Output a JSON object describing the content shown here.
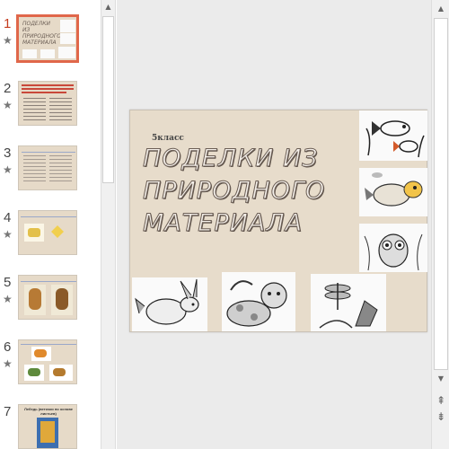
{
  "thumbnails": [
    {
      "number": "1",
      "star": "★",
      "active": true
    },
    {
      "number": "2",
      "star": "★"
    },
    {
      "number": "3",
      "star": "★"
    },
    {
      "number": "4",
      "star": "★"
    },
    {
      "number": "5",
      "star": "★"
    },
    {
      "number": "6",
      "star": "★"
    },
    {
      "number": "7",
      "star": ""
    }
  ],
  "slide": {
    "grade": "5класс",
    "title_lines": [
      "ПОДЕЛКИ  ИЗ",
      "ПРИРОДНОГО",
      "МАТЕРИАЛА"
    ],
    "background_color": "#e7dccb",
    "title_stroke_color": "#6c5f56"
  },
  "thumb_texts": {
    "slide1_title": "ПОДЕЛКИ ИЗ ПРИРОДНОГО МАТЕРИАЛА",
    "slide7_title": "Лебедь (веточки по основе листьев)"
  },
  "scrollbars": {
    "up_arrow": "▲",
    "down_arrow": "▼",
    "prev_slide": "⇞",
    "next_slide": "⇟"
  },
  "accent": "#e0674a"
}
